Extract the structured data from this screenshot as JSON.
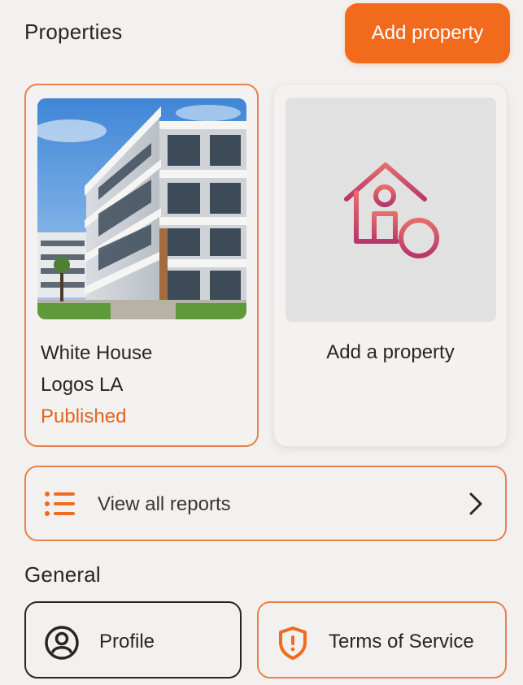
{
  "header": {
    "title": "Properties",
    "add_button_label": "Add property"
  },
  "properties": [
    {
      "name": "White House",
      "location": "Logos LA",
      "status": "Published",
      "image": "apartment-building-photo"
    }
  ],
  "add_card": {
    "label": "Add a property",
    "icon": "house-plus-icon"
  },
  "reports": {
    "label": "View all reports",
    "icon": "list-icon",
    "chevron": "chevron-right-icon"
  },
  "general": {
    "title": "General",
    "items": [
      {
        "label": "Profile",
        "icon": "user-circle-icon"
      },
      {
        "label": "Terms of Service",
        "icon": "shield-icon"
      }
    ]
  },
  "colors": {
    "accent": "#f26a1b",
    "accent_border": "#e9814a",
    "status_published": "#e0661f",
    "background": "#f3f1ef"
  }
}
